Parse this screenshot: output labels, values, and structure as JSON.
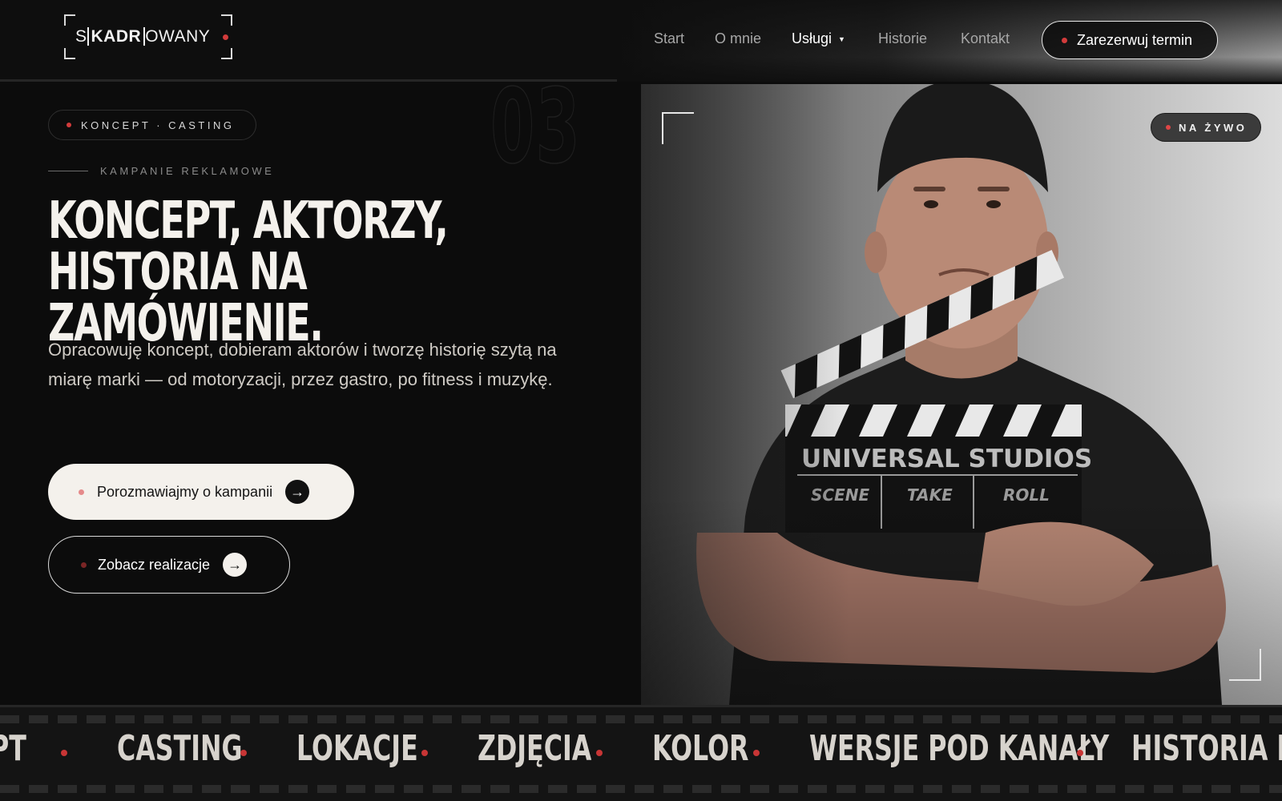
{
  "header": {
    "logo": {
      "prefix": "S",
      "highlight": "KADR",
      "suffix": "OWANY"
    },
    "nav": [
      {
        "label": "Start"
      },
      {
        "label": "O mnie"
      },
      {
        "label": "Usługi"
      },
      {
        "label": "Historie"
      },
      {
        "label": "Kontakt"
      }
    ],
    "active_nav": "Usługi",
    "cta_label": "Zarezerwuj termin"
  },
  "hero": {
    "number": "03",
    "tag": "KONCEPT · CASTING",
    "eyebrow": "KAMPANIE REKLAMOWE",
    "headline_line1": "KONCEPT, AKTORZY, HISTORIA NA",
    "headline_line2": "ZAMÓWIENIE.",
    "lead": "Opracowuję koncept, dobieram aktorów i tworzę historię szytą na miarę marki — od motoryzacji, przez gastro, po fitness i muzykę.",
    "primary_button": "Porozmawiajmy o kampanii",
    "secondary_button": "Zobacz realizacje",
    "arrow": "→"
  },
  "photo": {
    "live_badge": "NA ŻYWO",
    "clapper": {
      "brand": "UNIVERSAL STUDIOS",
      "col1": "SCENE",
      "col2": "TAKE",
      "col3": "ROLL"
    }
  },
  "ticker": {
    "items": [
      "PT",
      "CASTING",
      "LOKACJE",
      "ZDJĘCIA",
      "KOLOR",
      "WERSJE POD KANAŁY",
      "HISTORIA MA"
    ]
  },
  "colors": {
    "accent": "#d23b3b",
    "background": "#0c0c0c",
    "cream": "#f4f1ec"
  }
}
